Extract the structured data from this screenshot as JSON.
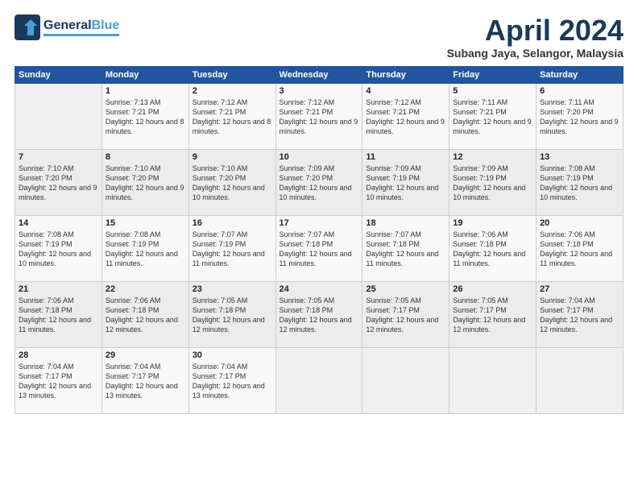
{
  "header": {
    "logo_line1": "General",
    "logo_line2": "Blue",
    "month": "April 2024",
    "location": "Subang Jaya, Selangor, Malaysia"
  },
  "days_of_week": [
    "Sunday",
    "Monday",
    "Tuesday",
    "Wednesday",
    "Thursday",
    "Friday",
    "Saturday"
  ],
  "weeks": [
    [
      {
        "day": "",
        "content": ""
      },
      {
        "day": "1",
        "content": "Sunrise: 7:13 AM\nSunset: 7:21 PM\nDaylight: 12 hours\nand 8 minutes."
      },
      {
        "day": "2",
        "content": "Sunrise: 7:12 AM\nSunset: 7:21 PM\nDaylight: 12 hours\nand 8 minutes."
      },
      {
        "day": "3",
        "content": "Sunrise: 7:12 AM\nSunset: 7:21 PM\nDaylight: 12 hours\nand 9 minutes."
      },
      {
        "day": "4",
        "content": "Sunrise: 7:12 AM\nSunset: 7:21 PM\nDaylight: 12 hours\nand 9 minutes."
      },
      {
        "day": "5",
        "content": "Sunrise: 7:11 AM\nSunset: 7:21 PM\nDaylight: 12 hours\nand 9 minutes."
      },
      {
        "day": "6",
        "content": "Sunrise: 7:11 AM\nSunset: 7:20 PM\nDaylight: 12 hours\nand 9 minutes."
      }
    ],
    [
      {
        "day": "7",
        "content": "Sunrise: 7:10 AM\nSunset: 7:20 PM\nDaylight: 12 hours\nand 9 minutes."
      },
      {
        "day": "8",
        "content": "Sunrise: 7:10 AM\nSunset: 7:20 PM\nDaylight: 12 hours\nand 9 minutes."
      },
      {
        "day": "9",
        "content": "Sunrise: 7:10 AM\nSunset: 7:20 PM\nDaylight: 12 hours\nand 10 minutes."
      },
      {
        "day": "10",
        "content": "Sunrise: 7:09 AM\nSunset: 7:20 PM\nDaylight: 12 hours\nand 10 minutes."
      },
      {
        "day": "11",
        "content": "Sunrise: 7:09 AM\nSunset: 7:19 PM\nDaylight: 12 hours\nand 10 minutes."
      },
      {
        "day": "12",
        "content": "Sunrise: 7:09 AM\nSunset: 7:19 PM\nDaylight: 12 hours\nand 10 minutes."
      },
      {
        "day": "13",
        "content": "Sunrise: 7:08 AM\nSunset: 7:19 PM\nDaylight: 12 hours\nand 10 minutes."
      }
    ],
    [
      {
        "day": "14",
        "content": "Sunrise: 7:08 AM\nSunset: 7:19 PM\nDaylight: 12 hours\nand 10 minutes."
      },
      {
        "day": "15",
        "content": "Sunrise: 7:08 AM\nSunset: 7:19 PM\nDaylight: 12 hours\nand 11 minutes."
      },
      {
        "day": "16",
        "content": "Sunrise: 7:07 AM\nSunset: 7:19 PM\nDaylight: 12 hours\nand 11 minutes."
      },
      {
        "day": "17",
        "content": "Sunrise: 7:07 AM\nSunset: 7:18 PM\nDaylight: 12 hours\nand 11 minutes."
      },
      {
        "day": "18",
        "content": "Sunrise: 7:07 AM\nSunset: 7:18 PM\nDaylight: 12 hours\nand 11 minutes."
      },
      {
        "day": "19",
        "content": "Sunrise: 7:06 AM\nSunset: 7:18 PM\nDaylight: 12 hours\nand 11 minutes."
      },
      {
        "day": "20",
        "content": "Sunrise: 7:06 AM\nSunset: 7:18 PM\nDaylight: 12 hours\nand 11 minutes."
      }
    ],
    [
      {
        "day": "21",
        "content": "Sunrise: 7:06 AM\nSunset: 7:18 PM\nDaylight: 12 hours\nand 11 minutes."
      },
      {
        "day": "22",
        "content": "Sunrise: 7:06 AM\nSunset: 7:18 PM\nDaylight: 12 hours\nand 12 minutes."
      },
      {
        "day": "23",
        "content": "Sunrise: 7:05 AM\nSunset: 7:18 PM\nDaylight: 12 hours\nand 12 minutes."
      },
      {
        "day": "24",
        "content": "Sunrise: 7:05 AM\nSunset: 7:18 PM\nDaylight: 12 hours\nand 12 minutes."
      },
      {
        "day": "25",
        "content": "Sunrise: 7:05 AM\nSunset: 7:17 PM\nDaylight: 12 hours\nand 12 minutes."
      },
      {
        "day": "26",
        "content": "Sunrise: 7:05 AM\nSunset: 7:17 PM\nDaylight: 12 hours\nand 12 minutes."
      },
      {
        "day": "27",
        "content": "Sunrise: 7:04 AM\nSunset: 7:17 PM\nDaylight: 12 hours\nand 12 minutes."
      }
    ],
    [
      {
        "day": "28",
        "content": "Sunrise: 7:04 AM\nSunset: 7:17 PM\nDaylight: 12 hours\nand 13 minutes."
      },
      {
        "day": "29",
        "content": "Sunrise: 7:04 AM\nSunset: 7:17 PM\nDaylight: 12 hours\nand 13 minutes."
      },
      {
        "day": "30",
        "content": "Sunrise: 7:04 AM\nSunset: 7:17 PM\nDaylight: 12 hours\nand 13 minutes."
      },
      {
        "day": "",
        "content": ""
      },
      {
        "day": "",
        "content": ""
      },
      {
        "day": "",
        "content": ""
      },
      {
        "day": "",
        "content": ""
      }
    ]
  ]
}
